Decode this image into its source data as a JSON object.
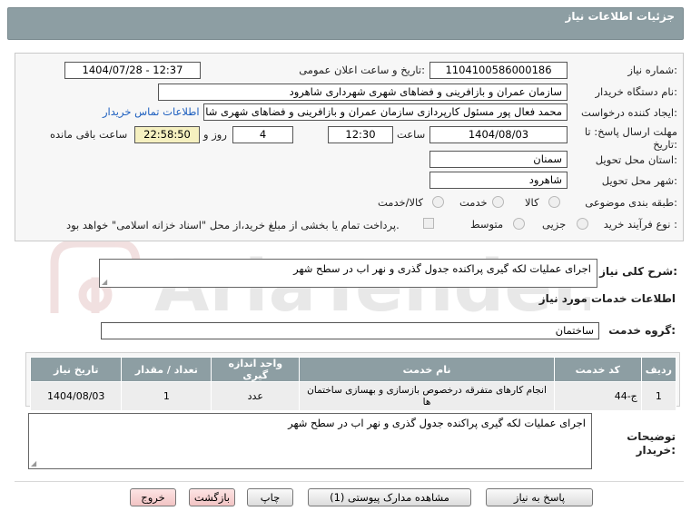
{
  "header": {
    "title": "جزئیات اطلاعات نیاز"
  },
  "fields": {
    "need_number_label": "شماره نیاز:",
    "need_number": "1104100586000186",
    "announce_label": "تاریخ و ساعت اعلان عمومی:",
    "announce_value": "1404/07/28 - 12:37",
    "buyer_org_label": "نام دستگاه خریدار:",
    "buyer_org": "سازمان عمران و بازافرینی و فضاهای شهری شهرداری شاهرود",
    "requester_label": "ایجاد کننده درخواست:",
    "requester": "محمد فعال پور مسئول کارپردازی سازمان عمران و بازافرینی و فضاهای شهری شا",
    "contact_link": "اطلاعات تماس خریدار",
    "deadline_label_1": "مهلت ارسال پاسخ: تا",
    "deadline_label_2": "تاریخ:",
    "deadline_date": "1404/08/03",
    "hour_label": "ساعت",
    "deadline_time": "12:30",
    "days_value": "4",
    "days_label": "روز و",
    "remaining_time": "22:58:50",
    "remaining_label": "ساعت باقی مانده",
    "province_label": "استان محل تحویل:",
    "province": "سمنان",
    "city_label": "شهر محل تحویل:",
    "city": "شاهرود",
    "category_label": "طبقه بندی موضوعی:",
    "category_options": [
      "کالا",
      "خدمت",
      "کالا/خدمت"
    ],
    "process_label": "نوع فرآیند خرید :",
    "process_options": [
      "جزیی",
      "متوسط"
    ],
    "payment_note": "پرداخت تمام یا بخشی از مبلغ خرید،از محل \"اسناد خزانه اسلامی\" خواهد بود."
  },
  "summary": {
    "label": "شرح کلی نیاز:",
    "text": "اجرای عملیات لکه گیری پراکنده جدول گذری و نهر اب در سطح شهر"
  },
  "services": {
    "section_title": "اطلاعات خدمات مورد نیاز",
    "group_label": "گروه خدمت:",
    "group_value": "ساختمان",
    "columns": [
      "ردیف",
      "کد خدمت",
      "نام خدمت",
      "واحد اندازه گیری",
      "تعداد / مقدار",
      "تاریخ نیاز"
    ],
    "rows": [
      [
        "1",
        "ج-44",
        "انجام کارهای متفرقه درخصوص بازسازی و بهسازی ساختمان ها",
        "عدد",
        "1",
        "1404/08/03"
      ]
    ]
  },
  "description": {
    "label_1": "توضیحات",
    "label_2": "خریدار:",
    "text": "اجرای عملیات لکه گیری پراکنده جدول گذری و نهر اب در سطح شهر"
  },
  "buttons": {
    "reply": "پاسخ به نیاز",
    "attachments": "مشاهده مدارک پیوستی (1)",
    "print": "چاپ",
    "back": "بازگشت",
    "exit": "خروج"
  },
  "watermark": "AriaTender.net",
  "colors": {
    "header": "#8d9ea3",
    "link": "#1d5fbf",
    "time_bg": "#f5f0c0",
    "exit_bg": "#f2c4c4"
  }
}
